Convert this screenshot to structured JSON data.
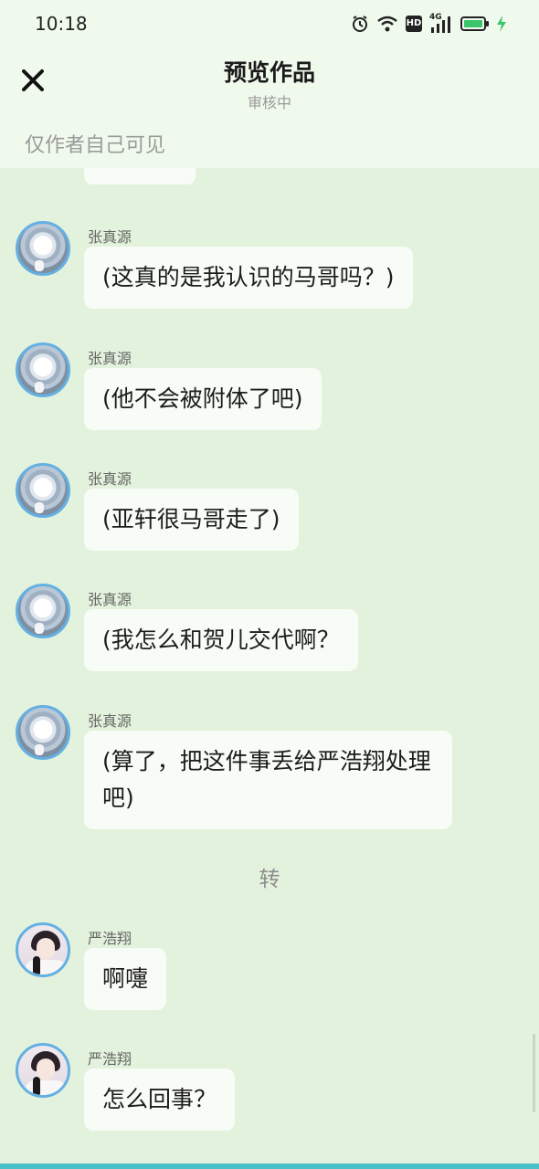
{
  "status": {
    "time": "10:18",
    "icons": [
      "alarm-icon",
      "wifi-icon",
      "hd-icon",
      "signal-4g-icon",
      "battery-icon",
      "charging-icon"
    ],
    "net_badge": "HD",
    "net_type": "4G"
  },
  "header": {
    "title": "预览作品",
    "subtitle": "审核中",
    "close_icon": "close-icon"
  },
  "visibility": "仅作者自己可见",
  "messages": [
    {
      "name": "张真源",
      "text": "(这真的是我认识的马哥吗？)"
    },
    {
      "name": "张真源",
      "text": "(他不会被附体了吧)"
    },
    {
      "name": "张真源",
      "text": "(亚轩很马哥走了)"
    },
    {
      "name": "张真源",
      "text": "(我怎么和贺儿交代啊？"
    },
    {
      "name": "张真源",
      "text": "(算了，把这件事丢给严浩翔处理吧)"
    },
    {
      "name": "严浩翔",
      "text": "啊嚏"
    },
    {
      "name": "严浩翔",
      "text": "怎么回事？"
    }
  ],
  "divider": "转",
  "colors": {
    "background": "#e3f2dc",
    "bubble": "#f8fcf6",
    "avatar_ring": "#64b0e3",
    "accent": "#48c2c8"
  }
}
